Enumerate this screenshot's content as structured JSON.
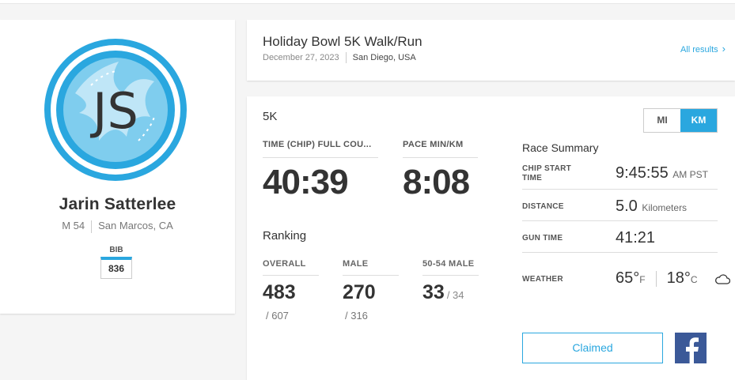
{
  "athlete": {
    "initials": "JS",
    "name": "Jarin Satterlee",
    "gender_age": "M 54",
    "location": "San Marcos, CA",
    "bib_label": "BIB",
    "bib": "836"
  },
  "event": {
    "name": "Holiday Bowl 5K Walk/Run",
    "date": "December 27, 2023",
    "location": "San Diego, USA",
    "all_results_label": "All results"
  },
  "result": {
    "race_type": "5K",
    "time_label": "TIME (CHIP) FULL COU...",
    "time": "40:39",
    "pace_label": "PACE MIN/KM",
    "pace": "8:08",
    "ranking_title": "Ranking",
    "overall_label": "OVERALL",
    "overall": "483",
    "overall_of": "/ 607",
    "gender_label": "MALE",
    "gender_rank": "270",
    "gender_of": "/ 316",
    "ag_label": "50-54 MALE",
    "ag_rank": "33",
    "ag_of": "/ 34"
  },
  "units": {
    "mi": "MI",
    "km": "KM",
    "selected": "KM"
  },
  "summary": {
    "title": "Race Summary",
    "chip_start_label": "CHIP START TIME",
    "chip_start": "9:45:55",
    "chip_start_suffix": "AM PST",
    "distance_label": "DISTANCE",
    "distance": "5.0",
    "distance_unit": "Kilometers",
    "gun_time_label": "GUN TIME",
    "gun_time": "41:21",
    "weather_label": "WEATHER",
    "temp_f": "65°",
    "temp_f_unit": "F",
    "temp_c": "18°",
    "temp_c_unit": "C",
    "weather_icon": "cloud-icon"
  },
  "actions": {
    "claimed_label": "Claimed",
    "facebook_icon": "facebook-icon"
  },
  "colors": {
    "accent": "#2aa7df",
    "facebook": "#3b5998",
    "text": "#333333"
  }
}
